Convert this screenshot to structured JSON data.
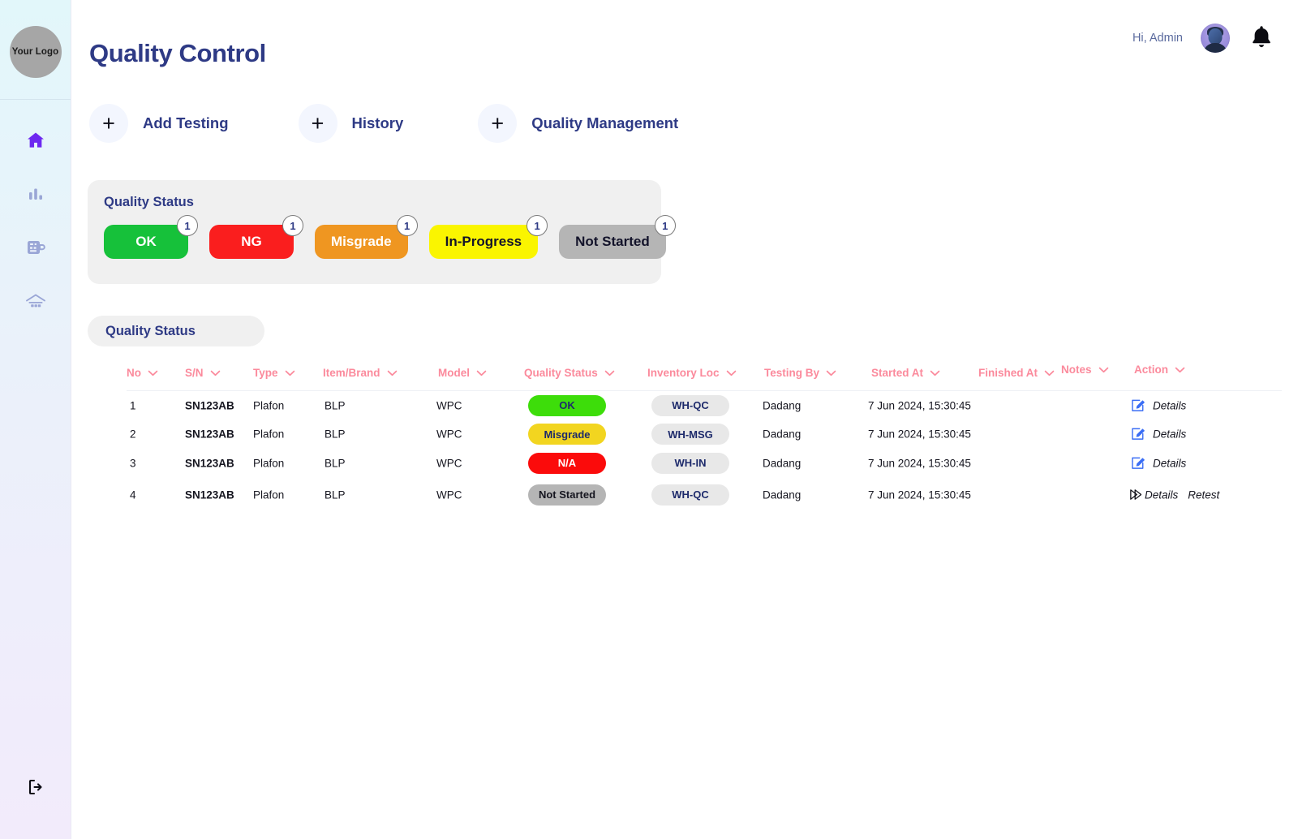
{
  "sidebar": {
    "logo_label": "Your Logo",
    "items": [
      {
        "name": "home",
        "icon": "home-icon",
        "active": true
      },
      {
        "name": "analytics",
        "icon": "bar-chart-icon",
        "active": false
      },
      {
        "name": "machine",
        "icon": "machine-icon",
        "active": false
      },
      {
        "name": "warehouse",
        "icon": "warehouse-icon",
        "active": false
      }
    ],
    "logout_icon": "logout-icon"
  },
  "header": {
    "title": "Quality Control",
    "greeting": "Hi, Admin",
    "avatar_icon": "user-avatar",
    "bell_icon": "bell-icon"
  },
  "actions": [
    {
      "label": "Add Testing",
      "icon": "plus-icon"
    },
    {
      "label": "History",
      "icon": "plus-icon"
    },
    {
      "label": "Quality Management",
      "icon": "plus-icon"
    }
  ],
  "quality_status_card": {
    "title": "Quality Status",
    "pills": [
      {
        "label": "OK",
        "count": "1",
        "color": "#16c13a",
        "variant": "ok"
      },
      {
        "label": "NG",
        "count": "1",
        "color": "#fa1e1e",
        "variant": "ng"
      },
      {
        "label": "Misgrade",
        "count": "1",
        "color": "#ef9621",
        "variant": "misgrade"
      },
      {
        "label": "In-Progress",
        "count": "1",
        "color": "#faf500",
        "variant": "inprogress"
      },
      {
        "label": "Not Started",
        "count": "1",
        "color": "#b5b5b5",
        "variant": "notstarted"
      }
    ]
  },
  "filter_tab": {
    "label": "Quality Status"
  },
  "table": {
    "header_color": "#fb8a9c",
    "columns": [
      {
        "label": "No"
      },
      {
        "label": "S/N"
      },
      {
        "label": "Type"
      },
      {
        "label": "Item/Brand"
      },
      {
        "label": "Model"
      },
      {
        "label": "Quality Status"
      },
      {
        "label": "Inventory Loc"
      },
      {
        "label": "Testing By"
      },
      {
        "label": "Started At"
      },
      {
        "label": "Finished At"
      },
      {
        "label": "Notes"
      },
      {
        "label": "Action"
      }
    ],
    "rows": [
      {
        "no": "1",
        "sn": "SN123AB",
        "type": "Plafon",
        "item_brand": "BLP",
        "model": "WPC",
        "quality_status": "OK",
        "status_variant": "ok",
        "inventory_loc": "WH-QC",
        "testing_by": "Dadang",
        "started_at": "7 Jun 2024, 15:30:45",
        "finished_at": "",
        "notes": "",
        "actions": [
          {
            "label": "Details",
            "icon": "edit-icon"
          }
        ]
      },
      {
        "no": "2",
        "sn": "SN123AB",
        "type": "Plafon",
        "item_brand": "BLP",
        "model": "WPC",
        "quality_status": "Misgrade",
        "status_variant": "misgrade",
        "inventory_loc": "WH-MSG",
        "testing_by": "Dadang",
        "started_at": "7 Jun 2024, 15:30:45",
        "finished_at": "",
        "notes": "",
        "actions": [
          {
            "label": "Details",
            "icon": "edit-icon"
          }
        ]
      },
      {
        "no": "3",
        "sn": "SN123AB",
        "type": "Plafon",
        "item_brand": "BLP",
        "model": "WPC",
        "quality_status": "N/A",
        "status_variant": "na",
        "inventory_loc": "WH-IN",
        "testing_by": "Dadang",
        "started_at": "7 Jun 2024, 15:30:45",
        "finished_at": "",
        "notes": "",
        "actions": [
          {
            "label": "Details",
            "icon": "edit-icon"
          }
        ]
      },
      {
        "no": "4",
        "sn": "SN123AB",
        "type": "Plafon",
        "item_brand": "BLP",
        "model": "WPC",
        "quality_status": "Not Started",
        "status_variant": "notstarted",
        "inventory_loc": "WH-QC",
        "testing_by": "Dadang",
        "started_at": "7 Jun 2024, 15:30:45",
        "finished_at": "",
        "notes": "",
        "actions": [
          {
            "label": "Details",
            "icon": "play-icon"
          },
          {
            "label": "Retest",
            "icon": "none"
          }
        ]
      }
    ]
  }
}
